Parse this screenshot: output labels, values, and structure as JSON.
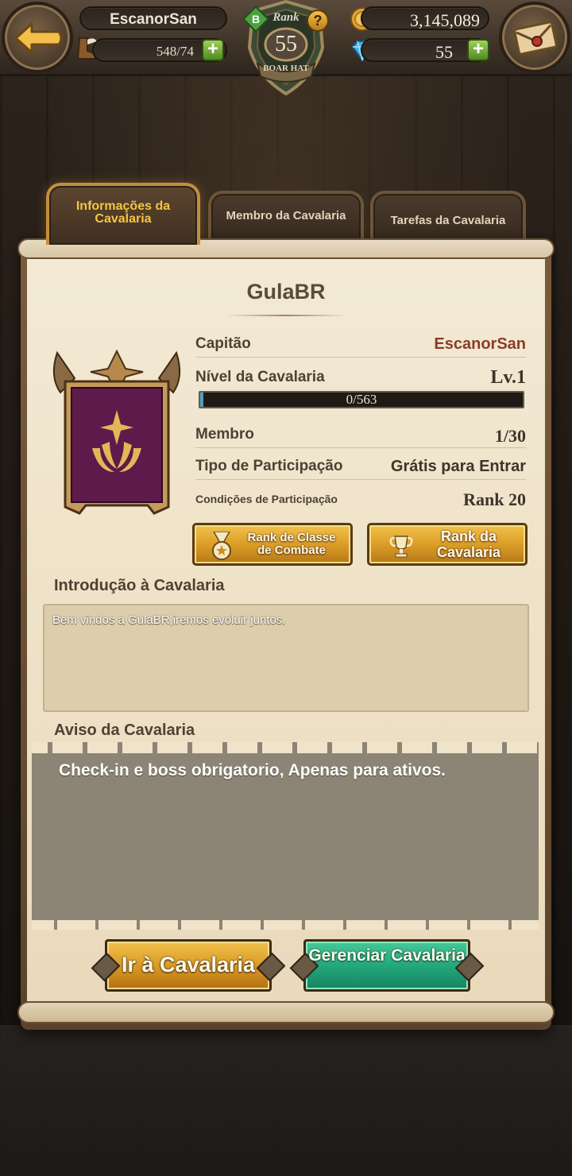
{
  "player": {
    "name": "EscanorSan",
    "stamina": "548/74",
    "gold": "3,145,089",
    "gems": "55",
    "rank_label": "Rank",
    "rank_value": "55",
    "rank_title": "BOAR HAT",
    "rank_badge": "B",
    "help_label": "?"
  },
  "tabs": [
    {
      "label": "Informações da Cavalaria",
      "active": true
    },
    {
      "label": "Membro da Cavalaria",
      "active": false
    },
    {
      "label": "Tarefas da Cavalaria",
      "active": false
    }
  ],
  "guild": {
    "name": "GulaBR",
    "captain_label": "Capitão",
    "captain_value": "EscanorSan",
    "level_label": "Nível da Cavalaria",
    "level_value": "Lv.1",
    "xp_text": "0/563",
    "xp_fraction": 0.01,
    "member_label": "Membro",
    "member_value": "1/30",
    "type_label": "Tipo de Participação",
    "type_value": "Grátis para Entrar",
    "cond_label": "Condições de Participação",
    "cond_value": "Rank 20"
  },
  "buttons": {
    "class_rank": "Rank de Classe de Combate",
    "cav_rank": "Rank da Cavalaria",
    "go": "Ir à Cavalaria",
    "manage": "Gerenciar Cavalaria"
  },
  "intro": {
    "title": "Introdução à Cavalaria",
    "text": "Bem vindos a GulaBR,iremos evoluir juntos."
  },
  "notice": {
    "title": "Aviso da Cavalaria",
    "text": "Check-in e boss obrigatorio, Apenas para ativos."
  },
  "colors": {
    "crest_banner": "#5e1a4a",
    "tab_active": "#f6c542",
    "manage_button": "#1fa177",
    "go_button": "#d6931f"
  }
}
